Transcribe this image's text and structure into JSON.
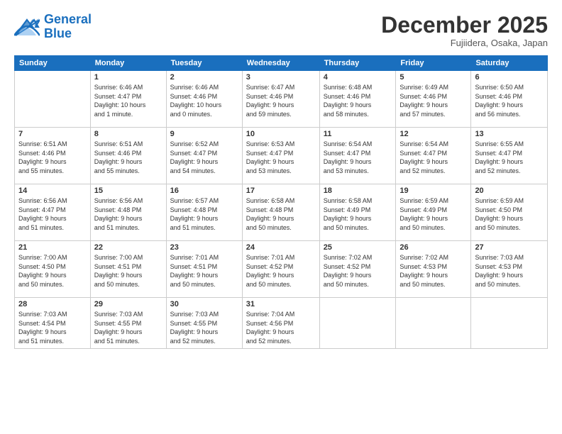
{
  "header": {
    "logo_line1": "General",
    "logo_line2": "Blue",
    "month": "December 2025",
    "location": "Fujiidera, Osaka, Japan"
  },
  "weekdays": [
    "Sunday",
    "Monday",
    "Tuesday",
    "Wednesday",
    "Thursday",
    "Friday",
    "Saturday"
  ],
  "weeks": [
    [
      {
        "day": "",
        "info": ""
      },
      {
        "day": "1",
        "info": "Sunrise: 6:46 AM\nSunset: 4:47 PM\nDaylight: 10 hours\nand 1 minute."
      },
      {
        "day": "2",
        "info": "Sunrise: 6:46 AM\nSunset: 4:46 PM\nDaylight: 10 hours\nand 0 minutes."
      },
      {
        "day": "3",
        "info": "Sunrise: 6:47 AM\nSunset: 4:46 PM\nDaylight: 9 hours\nand 59 minutes."
      },
      {
        "day": "4",
        "info": "Sunrise: 6:48 AM\nSunset: 4:46 PM\nDaylight: 9 hours\nand 58 minutes."
      },
      {
        "day": "5",
        "info": "Sunrise: 6:49 AM\nSunset: 4:46 PM\nDaylight: 9 hours\nand 57 minutes."
      },
      {
        "day": "6",
        "info": "Sunrise: 6:50 AM\nSunset: 4:46 PM\nDaylight: 9 hours\nand 56 minutes."
      }
    ],
    [
      {
        "day": "7",
        "info": "Sunrise: 6:51 AM\nSunset: 4:46 PM\nDaylight: 9 hours\nand 55 minutes."
      },
      {
        "day": "8",
        "info": "Sunrise: 6:51 AM\nSunset: 4:46 PM\nDaylight: 9 hours\nand 55 minutes."
      },
      {
        "day": "9",
        "info": "Sunrise: 6:52 AM\nSunset: 4:47 PM\nDaylight: 9 hours\nand 54 minutes."
      },
      {
        "day": "10",
        "info": "Sunrise: 6:53 AM\nSunset: 4:47 PM\nDaylight: 9 hours\nand 53 minutes."
      },
      {
        "day": "11",
        "info": "Sunrise: 6:54 AM\nSunset: 4:47 PM\nDaylight: 9 hours\nand 53 minutes."
      },
      {
        "day": "12",
        "info": "Sunrise: 6:54 AM\nSunset: 4:47 PM\nDaylight: 9 hours\nand 52 minutes."
      },
      {
        "day": "13",
        "info": "Sunrise: 6:55 AM\nSunset: 4:47 PM\nDaylight: 9 hours\nand 52 minutes."
      }
    ],
    [
      {
        "day": "14",
        "info": "Sunrise: 6:56 AM\nSunset: 4:47 PM\nDaylight: 9 hours\nand 51 minutes."
      },
      {
        "day": "15",
        "info": "Sunrise: 6:56 AM\nSunset: 4:48 PM\nDaylight: 9 hours\nand 51 minutes."
      },
      {
        "day": "16",
        "info": "Sunrise: 6:57 AM\nSunset: 4:48 PM\nDaylight: 9 hours\nand 51 minutes."
      },
      {
        "day": "17",
        "info": "Sunrise: 6:58 AM\nSunset: 4:48 PM\nDaylight: 9 hours\nand 50 minutes."
      },
      {
        "day": "18",
        "info": "Sunrise: 6:58 AM\nSunset: 4:49 PM\nDaylight: 9 hours\nand 50 minutes."
      },
      {
        "day": "19",
        "info": "Sunrise: 6:59 AM\nSunset: 4:49 PM\nDaylight: 9 hours\nand 50 minutes."
      },
      {
        "day": "20",
        "info": "Sunrise: 6:59 AM\nSunset: 4:50 PM\nDaylight: 9 hours\nand 50 minutes."
      }
    ],
    [
      {
        "day": "21",
        "info": "Sunrise: 7:00 AM\nSunset: 4:50 PM\nDaylight: 9 hours\nand 50 minutes."
      },
      {
        "day": "22",
        "info": "Sunrise: 7:00 AM\nSunset: 4:51 PM\nDaylight: 9 hours\nand 50 minutes."
      },
      {
        "day": "23",
        "info": "Sunrise: 7:01 AM\nSunset: 4:51 PM\nDaylight: 9 hours\nand 50 minutes."
      },
      {
        "day": "24",
        "info": "Sunrise: 7:01 AM\nSunset: 4:52 PM\nDaylight: 9 hours\nand 50 minutes."
      },
      {
        "day": "25",
        "info": "Sunrise: 7:02 AM\nSunset: 4:52 PM\nDaylight: 9 hours\nand 50 minutes."
      },
      {
        "day": "26",
        "info": "Sunrise: 7:02 AM\nSunset: 4:53 PM\nDaylight: 9 hours\nand 50 minutes."
      },
      {
        "day": "27",
        "info": "Sunrise: 7:03 AM\nSunset: 4:53 PM\nDaylight: 9 hours\nand 50 minutes."
      }
    ],
    [
      {
        "day": "28",
        "info": "Sunrise: 7:03 AM\nSunset: 4:54 PM\nDaylight: 9 hours\nand 51 minutes."
      },
      {
        "day": "29",
        "info": "Sunrise: 7:03 AM\nSunset: 4:55 PM\nDaylight: 9 hours\nand 51 minutes."
      },
      {
        "day": "30",
        "info": "Sunrise: 7:03 AM\nSunset: 4:55 PM\nDaylight: 9 hours\nand 52 minutes."
      },
      {
        "day": "31",
        "info": "Sunrise: 7:04 AM\nSunset: 4:56 PM\nDaylight: 9 hours\nand 52 minutes."
      },
      {
        "day": "",
        "info": ""
      },
      {
        "day": "",
        "info": ""
      },
      {
        "day": "",
        "info": ""
      }
    ]
  ]
}
